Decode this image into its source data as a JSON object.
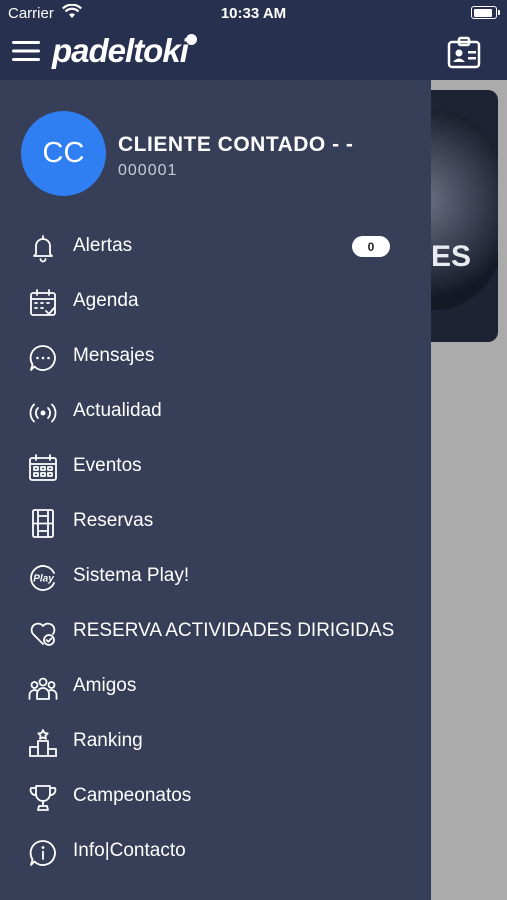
{
  "status_bar": {
    "carrier": "Carrier",
    "time": "10:33 AM",
    "battery_level": 0.9
  },
  "app_bar": {
    "logo_text": "padeltoki",
    "menu_icon": "hamburger-icon",
    "profile_icon": "id-card-icon"
  },
  "background_content": {
    "banner_text": "ES"
  },
  "user": {
    "initials": "CC",
    "name": "CLIENTE CONTADO - -",
    "code": "000001"
  },
  "menu": [
    {
      "label": "Alertas",
      "icon": "bell-icon",
      "badge": "0"
    },
    {
      "label": "Agenda",
      "icon": "calendar-check-icon"
    },
    {
      "label": "Mensajes",
      "icon": "chat-bubble-icon"
    },
    {
      "label": "Actualidad",
      "icon": "broadcast-icon"
    },
    {
      "label": "Eventos",
      "icon": "calendar-grid-icon"
    },
    {
      "label": "Reservas",
      "icon": "court-icon"
    },
    {
      "label": "Sistema Play!",
      "icon": "play-badge-icon"
    },
    {
      "label": "RESERVA ACTIVIDADES DIRIGIDAS",
      "icon": "heart-check-icon"
    },
    {
      "label": "Amigos",
      "icon": "group-icon"
    },
    {
      "label": "Ranking",
      "icon": "podium-icon"
    },
    {
      "label": "Campeonatos",
      "icon": "trophy-icon"
    },
    {
      "label": "Info|Contacto",
      "icon": "info-icon"
    }
  ],
  "colors": {
    "header": "#27304e",
    "drawer": "#363e58",
    "avatar": "#2f7ff3",
    "overlay": "#ababab"
  }
}
